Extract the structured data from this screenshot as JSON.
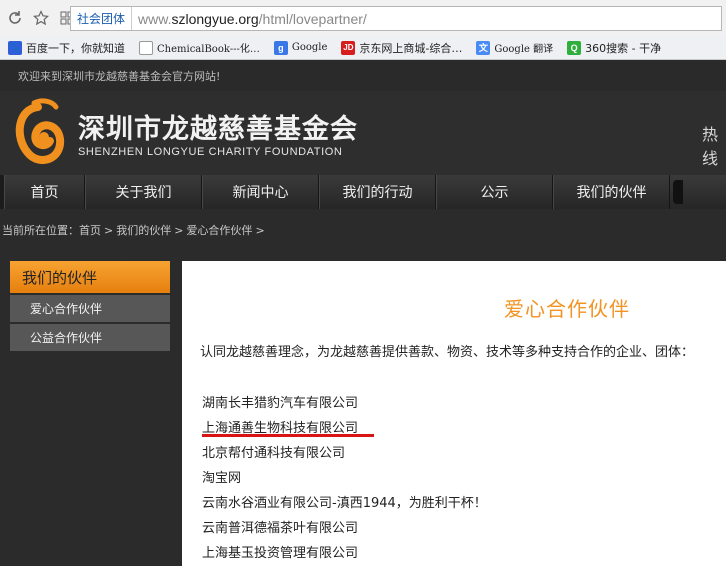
{
  "browser": {
    "url_tag": "社会团体",
    "url_prefix": "www.",
    "url_host": "szlongyue.org",
    "url_path": "/html/lovepartner/"
  },
  "bookmarks": [
    {
      "label": "百度一下，你就知道",
      "icon": "baidu-paw-icon"
    },
    {
      "label": "ChemicalBook---化…",
      "icon": "page-icon"
    },
    {
      "label": "Google",
      "icon": "google-icon"
    },
    {
      "label": "京东网上商城-综合…",
      "icon": "jd-icon"
    },
    {
      "label": "Google 翻译",
      "icon": "translate-icon"
    },
    {
      "label": "360搜索 - 干净",
      "icon": "360-search-icon"
    }
  ],
  "site": {
    "welcome": "欢迎来到深圳市龙越慈善基金会官方网站!",
    "name_cn": "深圳市龙越慈善基金会",
    "name_en": "SHENZHEN LONGYUE CHARITY FOUNDATION",
    "hot": "热线",
    "accent": "#f29323"
  },
  "nav": [
    "首页",
    "关于我们",
    "新闻中心",
    "我们的行动",
    "公示",
    "我们的伙伴"
  ],
  "breadcrumb": [
    "当前所在位置：首页",
    ">",
    "我们的伙伴",
    ">",
    "爱心合作伙伴",
    ">"
  ],
  "sidebar": {
    "title": "我们的伙伴",
    "items": [
      "爱心合作伙伴",
      "公益合作伙伴"
    ]
  },
  "content": {
    "title": "爱心合作伙伴",
    "intro": "认同龙越慈善理念，为龙越慈善提供善款、物资、技术等多种支持合作的企业、团体：",
    "partners": [
      "湖南长丰猎豹汽车有限公司",
      "上海通善生物科技有限公司",
      "北京帮付通科技有限公司",
      "淘宝网",
      "云南水谷酒业有限公司-滇西1944，为胜利干杯！",
      "云南普洱德福茶叶有限公司",
      "上海基玉投资管理有限公司"
    ]
  }
}
